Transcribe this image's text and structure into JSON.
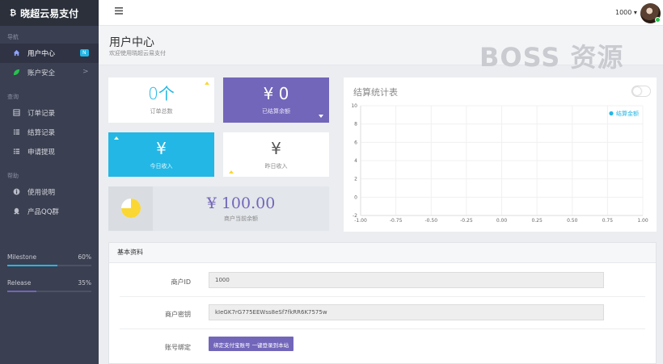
{
  "app": {
    "logo_icon": "bitcoin-icon",
    "logo_text": "晓超云易支付"
  },
  "sidebar": {
    "sections": [
      {
        "title": "导航",
        "items": [
          {
            "label": "用户中心",
            "icon": "home-icon",
            "badge": "N",
            "active": true
          },
          {
            "label": "账户安全",
            "icon": "leaf-icon",
            "chevron": ">"
          }
        ]
      },
      {
        "title": "查询",
        "items": [
          {
            "label": "订单记录",
            "icon": "table-icon"
          },
          {
            "label": "结算记录",
            "icon": "list-icon"
          },
          {
            "label": "申请提现",
            "icon": "list-icon"
          }
        ]
      },
      {
        "title": "帮助",
        "items": [
          {
            "label": "使用说明",
            "icon": "info-icon"
          },
          {
            "label": "产品QQ群",
            "icon": "qq-icon"
          }
        ]
      }
    ],
    "progress": [
      {
        "label": "Milestone",
        "percent": "60%",
        "value": 0.6,
        "color": "#23b7e5"
      },
      {
        "label": "Release",
        "percent": "35%",
        "value": 0.35,
        "color": "#7266ba"
      }
    ]
  },
  "header": {
    "menu_icon": "hamburger-icon",
    "user_id": "1000 ▾"
  },
  "page": {
    "title": "用户中心",
    "subtitle": "欢迎使用晓超云易支付",
    "watermark": "BOSS 资源"
  },
  "stats": {
    "orders": {
      "value": "0个",
      "label": "订单总数"
    },
    "settled": {
      "value": "¥ 0",
      "label": "已结算余额"
    },
    "today": {
      "value": "¥",
      "label": "今日收入"
    },
    "yesterday": {
      "value": "¥",
      "label": "昨日收入"
    },
    "balance": {
      "value": "¥ 100.00",
      "label": "商户当前余额"
    }
  },
  "colors": {
    "purple": "#7266ba",
    "cyan": "#23b7e5",
    "yellow": "#fad733",
    "sidebar": "#3a3f51"
  },
  "chart_data": {
    "type": "line",
    "title": "结算统计表",
    "legend": {
      "label": "结算金额",
      "placement": "top-right"
    },
    "xlim": [
      -1.0,
      1.0
    ],
    "ylim": [
      -2,
      10
    ],
    "x_ticks": [
      "-1.00",
      "-0.75",
      "-0.50",
      "-0.25",
      "0.00",
      "0.25",
      "0.50",
      "0.75",
      "1.00"
    ],
    "y_ticks": [
      "10",
      "8",
      "6",
      "4",
      "2",
      "0",
      "-2"
    ],
    "grid": true,
    "series": [
      {
        "name": "结算金额",
        "values": []
      }
    ]
  },
  "info": {
    "title": "基本资料",
    "merchant_id_label": "商户ID",
    "merchant_id": "1000",
    "merchant_key_label": "商户密钥",
    "merchant_key": "kIeGK7rG775EEWss8eSf7fkRR6K7575w",
    "bind_label": "账号绑定",
    "bind_button": "绑定支付宝账号 一键登录到本站"
  }
}
